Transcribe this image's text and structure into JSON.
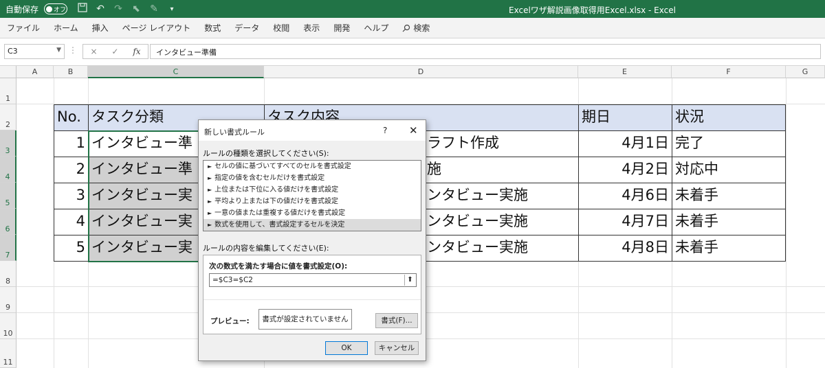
{
  "window": {
    "autosave_label": "自動保存",
    "autosave_state": "オフ",
    "title": "Excelワザ解説画像取得用Excel.xlsx  -  Excel",
    "accent_color": "#217346"
  },
  "ribbon": {
    "tabs": [
      "ファイル",
      "ホーム",
      "挿入",
      "ページ レイアウト",
      "数式",
      "データ",
      "校閲",
      "表示",
      "開発",
      "ヘルプ"
    ],
    "search_label": "検索"
  },
  "formula_bar": {
    "name_box": "C3",
    "fx": "fx",
    "cancel": "×",
    "enter": "✓",
    "value": "インタビュー準備"
  },
  "columns": [
    "A",
    "B",
    "C",
    "D",
    "E",
    "F",
    "G"
  ],
  "rows": [
    "1",
    "2",
    "3",
    "4",
    "5",
    "6",
    "7",
    "8",
    "9",
    "10",
    "11"
  ],
  "table": {
    "header": [
      "No.",
      "タスク分類",
      "タスク内容",
      "期日",
      "状況"
    ],
    "rows": [
      {
        "no": "1",
        "category": "インタビュー準",
        "content": "ラフト作成",
        "date": "4月1日",
        "status": "完了"
      },
      {
        "no": "2",
        "category": "インタビュー準",
        "content": "施",
        "date": "4月2日",
        "status": "対応中"
      },
      {
        "no": "3",
        "category": "インタビュー実",
        "content": "ンタビュー実施",
        "date": "4月6日",
        "status": "未着手"
      },
      {
        "no": "4",
        "category": "インタビュー実",
        "content": "ンタビュー実施",
        "date": "4月7日",
        "status": "未着手"
      },
      {
        "no": "5",
        "category": "インタビュー実",
        "content": "ンタビュー実施",
        "date": "4月8日",
        "status": "未着手"
      }
    ]
  },
  "dialog": {
    "title": "新しい書式ルール",
    "help": "?",
    "close": "✕",
    "rule_type_label": "ルールの種類を選択してください(S):",
    "rule_types": [
      "セルの値に基づいてすべてのセルを書式設定",
      "指定の値を含むセルだけを書式設定",
      "上位または下位に入る値だけを書式設定",
      "平均より上または下の値だけを書式設定",
      "一意の値または重複する値だけを書式設定",
      "数式を使用して、書式設定するセルを決定"
    ],
    "selected_rule_index": 5,
    "edit_label": "ルールの内容を編集してください(E):",
    "formula_label": "次の数式を満たす場合に値を書式設定(O):",
    "formula_value": "=$C3=$C2",
    "preview_label": "プレビュー:",
    "preview_text": "書式が設定されていません",
    "format_button": "書式(F)...",
    "ok": "OK",
    "cancel": "キャンセル"
  }
}
